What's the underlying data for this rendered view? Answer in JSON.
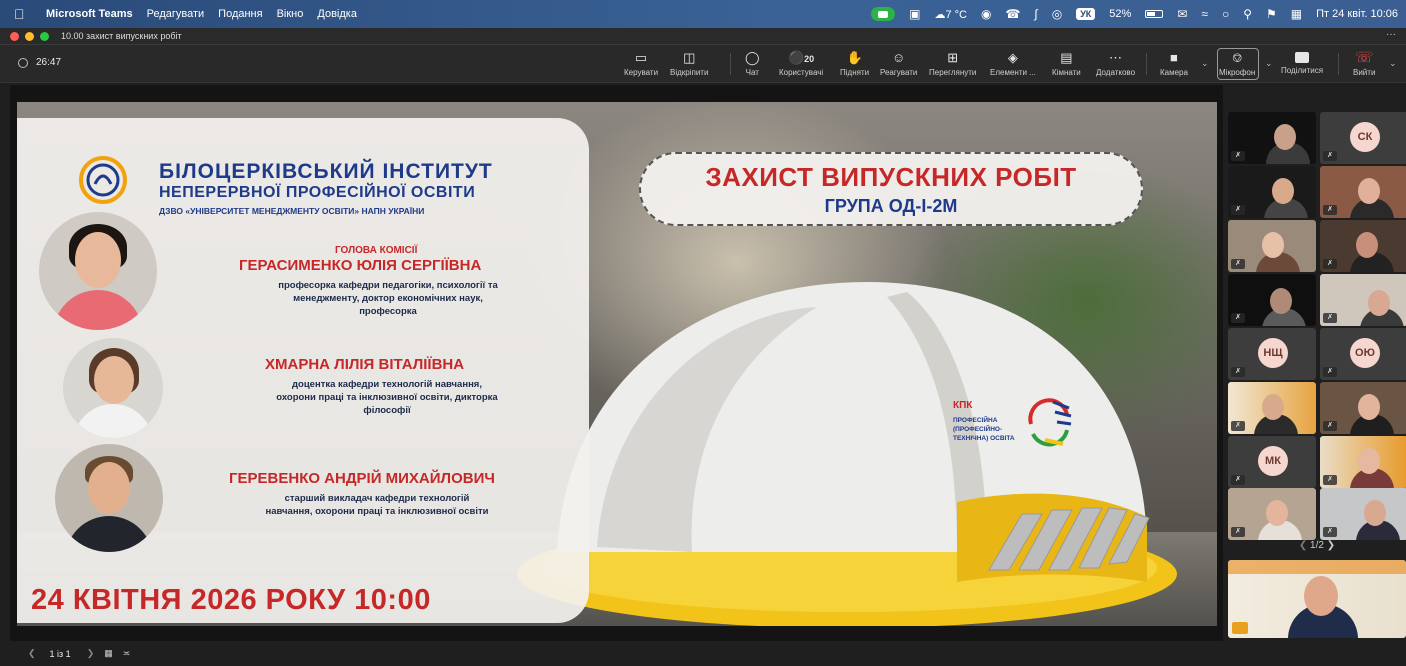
{
  "menubar": {
    "app": "Microsoft Teams",
    "menus": [
      "Редагувати",
      "Подання",
      "Вікно",
      "Довідка"
    ],
    "weather": "7 °C",
    "lang": "УК",
    "battery": "52%",
    "datetime": "Пт 24 квіт. 10:06"
  },
  "window": {
    "title": "10.00 захист випускних робіт",
    "more": "···"
  },
  "toolbar": {
    "timer": "26:47",
    "buttons": {
      "manage": "Керувати",
      "unpin": "Відкріпити",
      "chat": "Чат",
      "users_count": "20",
      "users": "Користувачі",
      "raise": "Підняти",
      "react": "Реагувати",
      "view": "Переглянути",
      "elements": "Елементи ...",
      "rooms": "Кімнати",
      "more": "Додатково",
      "camera": "Камера",
      "mic": "Мікрофон",
      "share": "Поділитися",
      "leave": "Вийти"
    }
  },
  "slide": {
    "inst_line1": "БІЛОЦЕРКІВСЬКИЙ ІНСТИТУТ",
    "inst_line2": "НЕПЕРЕРВНОЇ ПРОФЕСІЙНОЇ ОСВІТИ",
    "inst_line3": "ДЗВО «УНІВЕРСИТЕТ МЕНЕДЖМЕНТУ ОСВІТИ» НАПН УКРАЇНИ",
    "chair_label": "ГОЛОВА КОМІСІЇ",
    "people": [
      {
        "name": "ГЕРАСИМЕНКО ЮЛІЯ СЕРГІЇВНА",
        "desc": [
          "професорка кафедри педагогіки, психології та",
          "менеджменту, доктор економічних наук,",
          "професорка"
        ]
      },
      {
        "name": "ХМАРНА ЛІЛІЯ ВІТАЛІЇВНА",
        "desc": [
          "доцентка кафедри технологій навчання,",
          "охорони праці та інклюзивної освіти, дикторка",
          "філософії"
        ]
      },
      {
        "name": "ГЕРЕВЕНКО АНДРІЙ МИХАЙЛОВИЧ",
        "desc": [
          "старший викладач кафедри технологій",
          "навчання, охорони праці та інклюзивної освіти"
        ]
      }
    ],
    "date": "24 КВІТНЯ 2026 РОКУ 10:00",
    "banner_title": "ЗАХИСТ ВИПУСКНИХ РОБІТ",
    "banner_sub": "ГРУПА ОД-І-2М",
    "kpk_title": "КПК",
    "kpk_sub": [
      "ПРОФЕСІЙНА",
      "(ПРОФЕСІЙНО-",
      "ТЕХНІЧНА) ОСВІТА"
    ]
  },
  "stage_footer": {
    "page": "1 із 1"
  },
  "gallery": {
    "initials": [
      "СК",
      "НЩ",
      "ОЮ",
      "МК"
    ],
    "pager": "1/2"
  },
  "colors": {
    "accent_red": "#c62828",
    "accent_blue": "#1e3a8a",
    "leave": "#e5484d"
  }
}
